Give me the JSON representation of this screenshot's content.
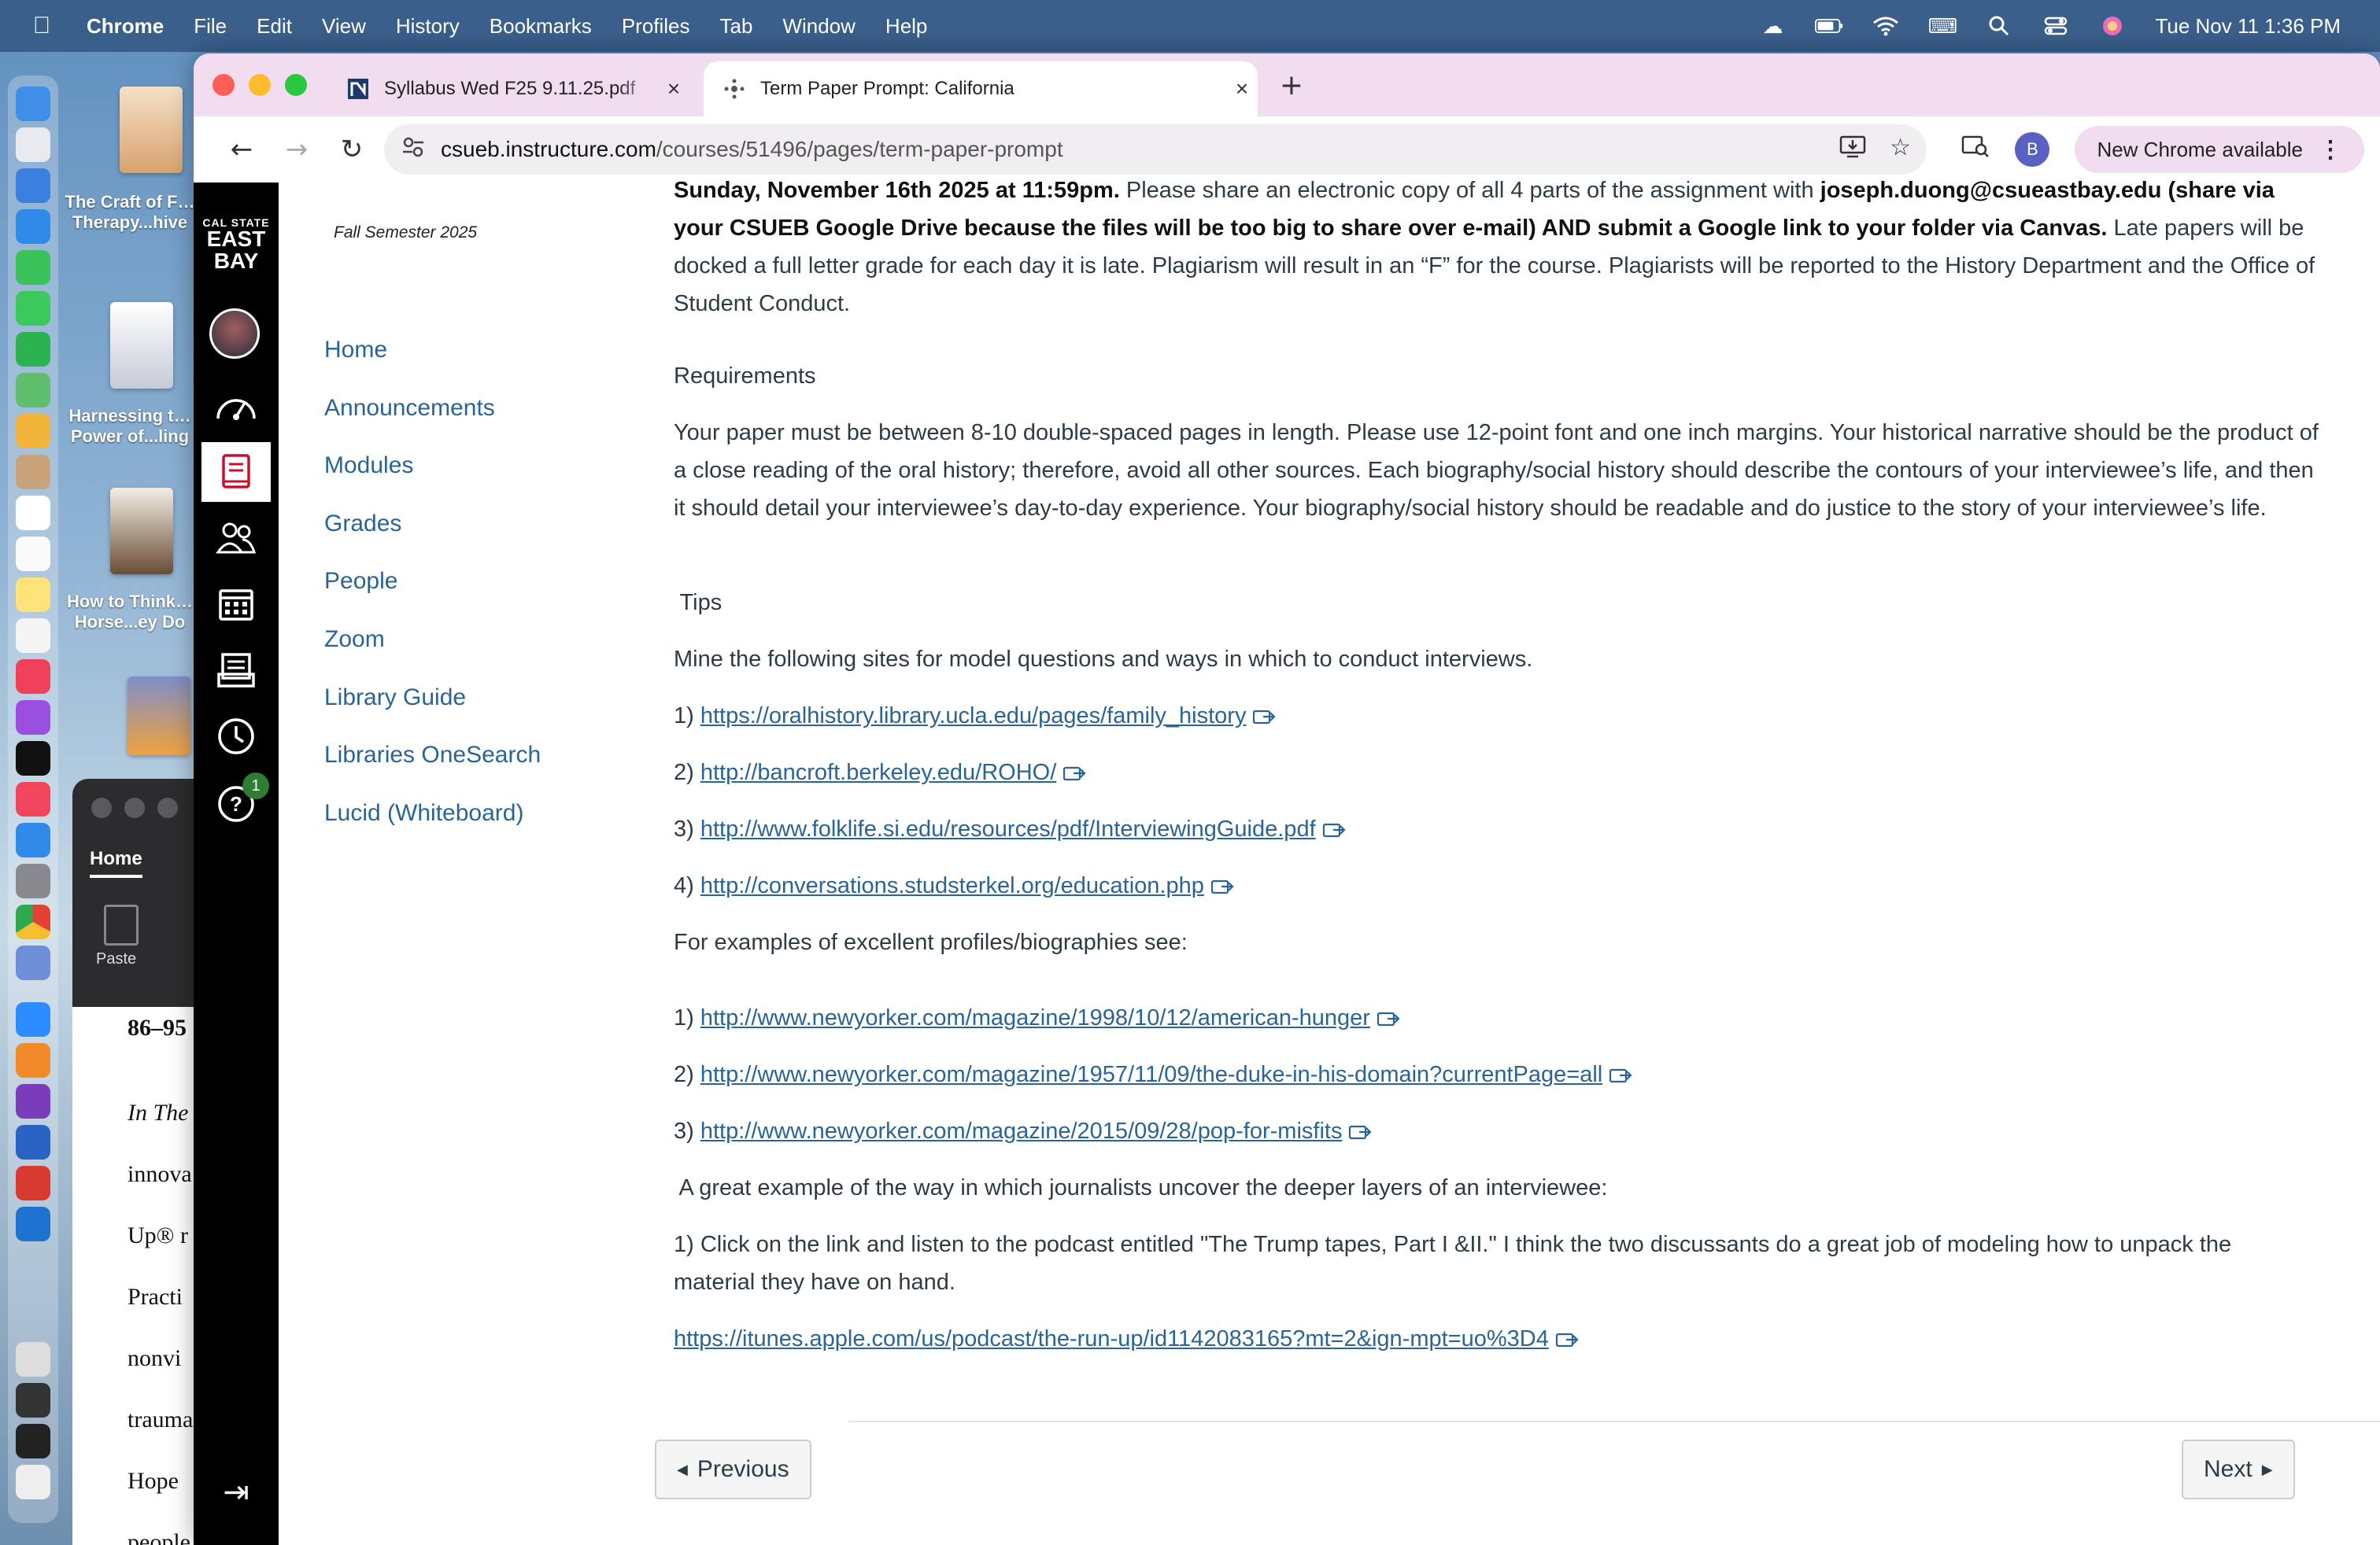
{
  "menubar": {
    "app": "Chrome",
    "items": [
      "File",
      "Edit",
      "View",
      "History",
      "Bookmarks",
      "Profiles",
      "Tab",
      "Window",
      "Help"
    ],
    "clock": "Tue Nov 11  1:36 PM"
  },
  "desktop": {
    "files": [
      {
        "label": "The Craft of F… Therapy...hive"
      },
      {
        "label": "Harnessing t… Power of...ling"
      },
      {
        "label": "How to Think… Horse...ey Do"
      }
    ]
  },
  "bg_window": {
    "home_tab": "Home",
    "paste_label": "Paste",
    "lines": [
      "86–95",
      "In The",
      "innova",
      "Up® r",
      "Practi",
      "nonvi",
      "trauma",
      "Hope",
      "people"
    ]
  },
  "tabs": [
    {
      "title": "Syllabus Wed F25 9.11.25.pdf",
      "active": false
    },
    {
      "title": "Term Paper Prompt: California",
      "active": true
    }
  ],
  "omnibox": {
    "host": "csueb.instructure.com",
    "path": "/courses/51496/pages/term-paper-prompt"
  },
  "toolbar": {
    "profile_initial": "B",
    "new_chrome": "New Chrome available"
  },
  "logo": {
    "line1": "CAL STATE",
    "line2": "EAST",
    "line3": "BAY"
  },
  "global_nav": {
    "help_badge": "1"
  },
  "course_nav": {
    "term": "Fall Semester 2025",
    "links": [
      "Home",
      "Announcements",
      "Modules",
      "Grades",
      "People",
      "Zoom",
      "Library Guide",
      "Libraries OneSearch",
      "Lucid (Whiteboard)"
    ]
  },
  "content": {
    "p1_bold_date": "Sunday, November 16th 2025 at 11:59pm.",
    "p1_text": " Please share an electronic copy of all 4 parts of the assignment with ",
    "p1_email": "joseph.duong@csueastbay.edu",
    "p1_bold2": "(share via your CSUEB Google Drive because the files will be too big to share over e-mail) AND submit a Google link to your folder via Canvas.",
    "p1_rest": " Late papers will be docked a full letter grade for each day it is late. Plagiarism will result in an “F” for the course. Plagiarists will be reported to the History Department and the Office of Student Conduct.",
    "requirements_heading": "Requirements",
    "requirements_text": "Your paper must be between 8-10 double-spaced pages in length. Please use 12-point font and one inch margins. Your historical narrative should be the product of a close reading of the oral history; therefore, avoid all other sources. Each biography/social history should describe the contours of your interviewee’s life, and then it should detail your interviewee’s day-to-day experience. Your biography/social history should be readable and do justice to the story of your interviewee’s life.",
    "tips_heading": " Tips",
    "mine_text": "Mine the following sites for model questions and ways in which to conduct interviews.",
    "interview_links": [
      {
        "num": "1) ",
        "url": "https://oralhistory.library.ucla.edu/pages/family_history"
      },
      {
        "num": "2) ",
        "url": "http://bancroft.berkeley.edu/ROHO/"
      },
      {
        "num": "3) ",
        "url": "http://www.folklife.si.edu/resources/pdf/InterviewingGuide.pdf"
      },
      {
        "num": "4) ",
        "url": "http://conversations.studsterkel.org/education.php"
      }
    ],
    "examples_text": "For examples of excellent profiles/biographies see:",
    "example_links": [
      {
        "num": "1) ",
        "url": "http://www.newyorker.com/magazine/1998/10/12/american-hunger"
      },
      {
        "num": "2) ",
        "url": "http://www.newyorker.com/magazine/1957/11/09/the-duke-in-his-domain?currentPage=all"
      },
      {
        "num": "3) ",
        "url": "http://www.newyorker.com/magazine/2015/09/28/pop-for-misfits"
      }
    ],
    "journalists_text": " A great example of the way in which journalists uncover the deeper layers of an interviewee:",
    "podcast_text": "1) Click on the link and listen to the podcast entitled \"The Trump tapes, Part I &II.\" I think the two discussants do a great job of modeling how to unpack the material they have on hand.",
    "podcast_url": "https://itunes.apple.com/us/podcast/the-run-up/id1142083165?mt=2&ign-mpt=uo%3D4"
  },
  "pager": {
    "previous": "Previous",
    "next": "Next"
  },
  "colors": {
    "link": "#2a6496",
    "canvas_nav": "#000000",
    "tab_strip": "#f2dcf0"
  }
}
